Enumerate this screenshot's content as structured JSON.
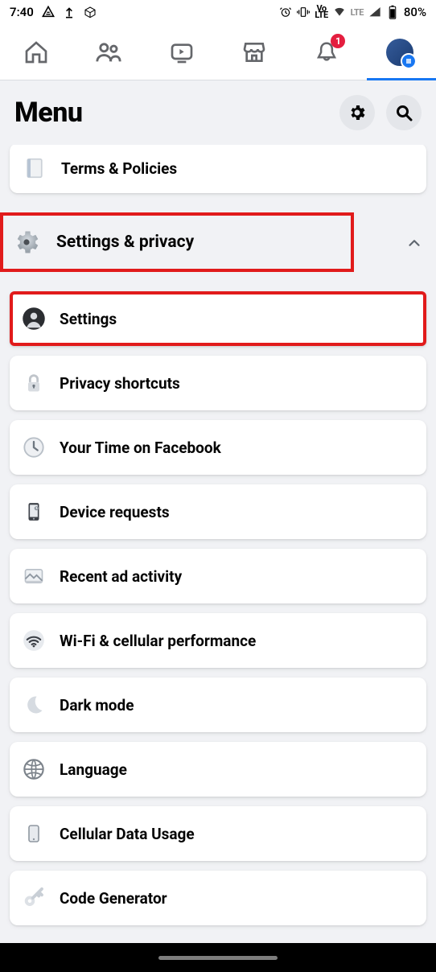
{
  "status": {
    "time": "7:40",
    "lte": "LTE",
    "volte": "Vo\nLTE",
    "battery_text": "80%"
  },
  "nav": {
    "badge_count": "1"
  },
  "header": {
    "title": "Menu"
  },
  "top_card": {
    "label": "Terms & Policies"
  },
  "section": {
    "label": "Settings & privacy"
  },
  "items": [
    {
      "label": "Settings"
    },
    {
      "label": "Privacy shortcuts"
    },
    {
      "label": "Your Time on Facebook"
    },
    {
      "label": "Device requests"
    },
    {
      "label": "Recent ad activity"
    },
    {
      "label": "Wi-Fi & cellular performance"
    },
    {
      "label": "Dark mode"
    },
    {
      "label": "Language"
    },
    {
      "label": "Cellular Data Usage"
    },
    {
      "label": "Code Generator"
    }
  ]
}
